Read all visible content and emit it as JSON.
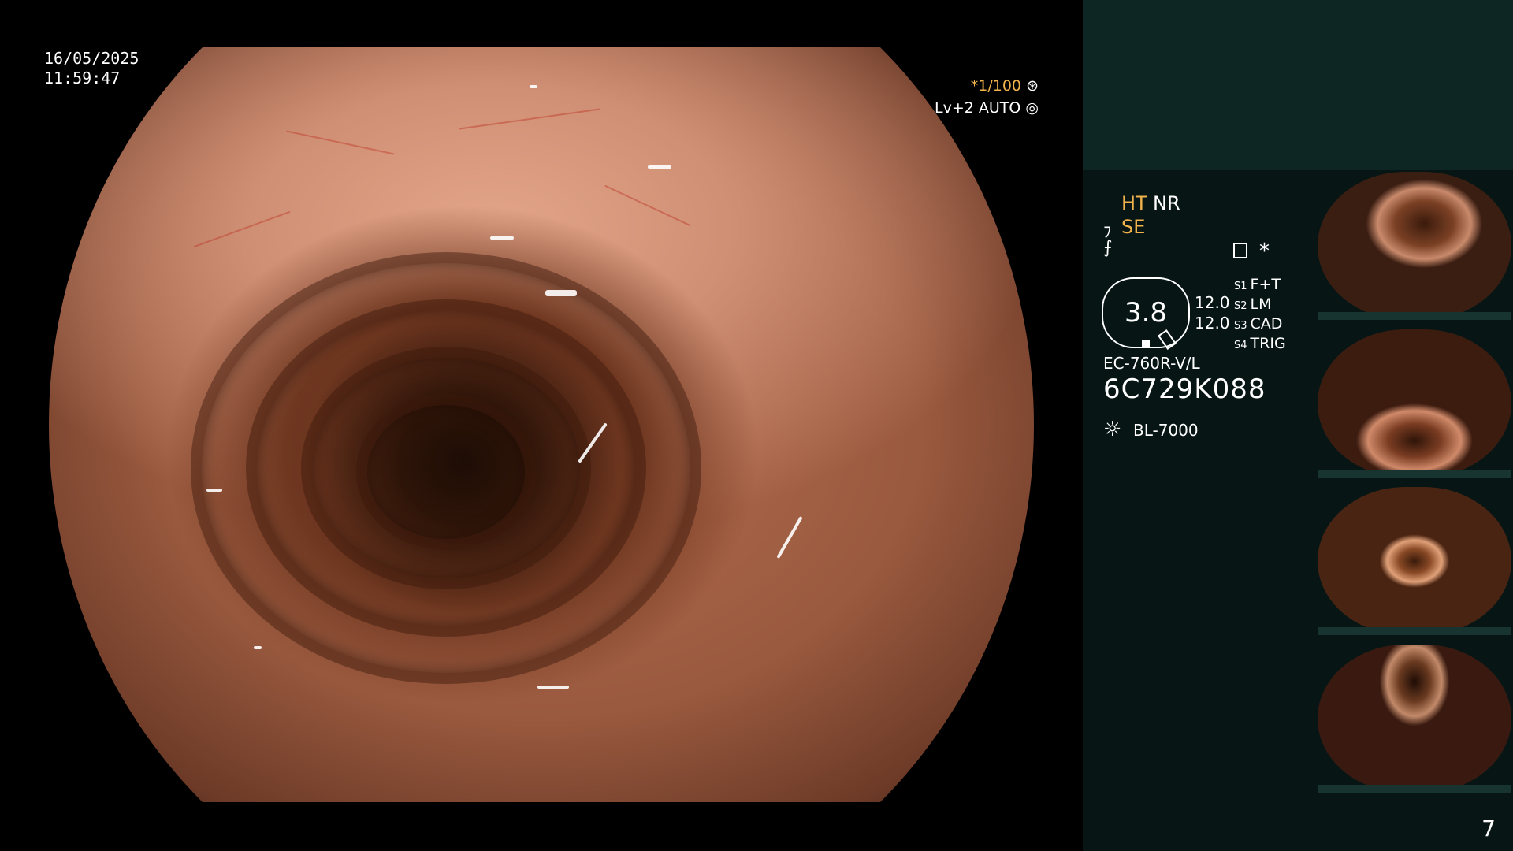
{
  "overlay": {
    "date": "16/05/2025",
    "time": "11:59:47",
    "shutter": "*1/100",
    "level": "Lv+2 AUTO"
  },
  "panel": {
    "mode_ht": "HT",
    "mode_nr": "NR",
    "mode_se": "SE",
    "gauge_value": "3.8",
    "value_a": "12.0",
    "value_b": "12.0",
    "switches": [
      {
        "key": "S1",
        "label": "F+T"
      },
      {
        "key": "S2",
        "label": "LM"
      },
      {
        "key": "S3",
        "label": "CAD"
      },
      {
        "key": "S4",
        "label": "TRIG"
      }
    ],
    "scope_model": "EC-760R-V/L",
    "scope_serial": "6C729K088",
    "light_source": "BL-7000",
    "page_number": "7"
  },
  "colors": {
    "accent": "#f2b34c",
    "panel_bg": "#071615",
    "panel_top_bg": "#0d2523"
  }
}
